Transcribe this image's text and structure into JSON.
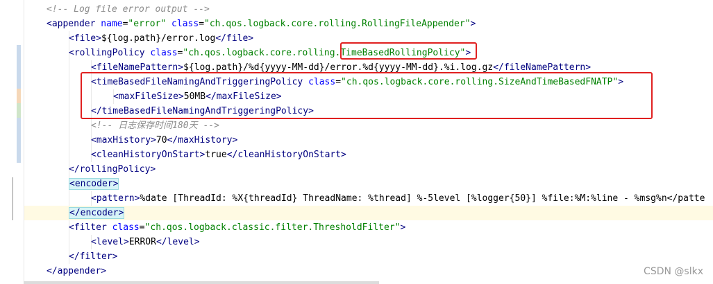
{
  "editor": {
    "language": "xml",
    "current_line_index": 14,
    "lines": [
      {
        "indent": 0,
        "tokens": [
          {
            "c": "comment",
            "t": "<!-- Log file error output -->"
          }
        ]
      },
      {
        "indent": 0,
        "tokens": [
          {
            "c": "tag",
            "t": "<appender "
          },
          {
            "c": "attr",
            "t": "name"
          },
          {
            "c": "text",
            "t": "="
          },
          {
            "c": "str",
            "t": "\"error\""
          },
          {
            "c": "text",
            "t": " "
          },
          {
            "c": "attr",
            "t": "class"
          },
          {
            "c": "text",
            "t": "="
          },
          {
            "c": "str",
            "t": "\"ch.qos.logback.core.rolling.RollingFileAppender\""
          },
          {
            "c": "tag",
            "t": ">"
          }
        ]
      },
      {
        "indent": 1,
        "tokens": [
          {
            "c": "tag",
            "t": "<file>"
          },
          {
            "c": "text",
            "t": "${log.path}/error.log"
          },
          {
            "c": "tag",
            "t": "</file>"
          }
        ]
      },
      {
        "indent": 1,
        "tokens": [
          {
            "c": "tag",
            "t": "<rollingPolicy "
          },
          {
            "c": "attr",
            "t": "class"
          },
          {
            "c": "text",
            "t": "="
          },
          {
            "c": "str",
            "t": "\"ch.qos.logback.core.rolling.TimeBasedRollingPolicy\""
          },
          {
            "c": "tag",
            "t": ">"
          }
        ]
      },
      {
        "indent": 2,
        "tokens": [
          {
            "c": "tag",
            "t": "<fileNamePattern>"
          },
          {
            "c": "text",
            "t": "${log.path}/%d{yyyy-MM-dd}/error.%d{yyyy-MM-dd}.%i.log.gz"
          },
          {
            "c": "tag",
            "t": "</fileNamePattern>"
          }
        ]
      },
      {
        "indent": 2,
        "tokens": [
          {
            "c": "tag",
            "t": "<timeBasedFileNamingAndTriggeringPolicy "
          },
          {
            "c": "attr",
            "t": "class"
          },
          {
            "c": "text",
            "t": "="
          },
          {
            "c": "str",
            "t": "\"ch.qos.logback.core.rolling.SizeAndTimeBasedFNATP\""
          },
          {
            "c": "tag",
            "t": ">"
          }
        ]
      },
      {
        "indent": 3,
        "tokens": [
          {
            "c": "tag",
            "t": "<maxFileSize>"
          },
          {
            "c": "text",
            "t": "50MB"
          },
          {
            "c": "tag",
            "t": "</maxFileSize>"
          }
        ]
      },
      {
        "indent": 2,
        "tokens": [
          {
            "c": "tag",
            "t": "</timeBasedFileNamingAndTriggeringPolicy>"
          }
        ]
      },
      {
        "indent": 2,
        "tokens": [
          {
            "c": "comment",
            "t": "<!-- 日志保存时间180天 -->"
          }
        ]
      },
      {
        "indent": 2,
        "tokens": [
          {
            "c": "tag",
            "t": "<maxHistory>"
          },
          {
            "c": "text",
            "t": "70"
          },
          {
            "c": "tag",
            "t": "</maxHistory>"
          }
        ]
      },
      {
        "indent": 2,
        "tokens": [
          {
            "c": "tag",
            "t": "<cleanHistoryOnStart>"
          },
          {
            "c": "text",
            "t": "true"
          },
          {
            "c": "tag",
            "t": "</cleanHistoryOnStart>"
          }
        ]
      },
      {
        "indent": 1,
        "tokens": [
          {
            "c": "tag",
            "t": "</rollingPolicy>"
          }
        ]
      },
      {
        "indent": 1,
        "tokens": [
          {
            "c": "taghl",
            "t": "<encoder>"
          }
        ]
      },
      {
        "indent": 2,
        "tokens": [
          {
            "c": "tag",
            "t": "<pattern>"
          },
          {
            "c": "text",
            "t": "%date [ThreadId: %X{threadId} ThreadName: %thread] %-5level [%logger{50}] %file:%M:%line - %msg%n</patte"
          }
        ]
      },
      {
        "indent": 1,
        "tokens": [
          {
            "c": "taghl",
            "t": "</encoder>"
          }
        ]
      },
      {
        "indent": 1,
        "tokens": [
          {
            "c": "tag",
            "t": "<filter "
          },
          {
            "c": "attr",
            "t": "class"
          },
          {
            "c": "text",
            "t": "="
          },
          {
            "c": "str",
            "t": "\"ch.qos.logback.classic.filter.ThresholdFilter\""
          },
          {
            "c": "tag",
            "t": ">"
          }
        ]
      },
      {
        "indent": 2,
        "tokens": [
          {
            "c": "tag",
            "t": "<level>"
          },
          {
            "c": "text",
            "t": "ERROR"
          },
          {
            "c": "tag",
            "t": "</level>"
          }
        ]
      },
      {
        "indent": 1,
        "tokens": [
          {
            "c": "tag",
            "t": "</filter>"
          }
        ]
      },
      {
        "indent": 0,
        "tokens": [
          {
            "c": "tag",
            "t": "</appender>"
          }
        ]
      }
    ]
  },
  "annotations": {
    "box1_text": "TimeBasedRollingPolicy",
    "box2_lines": "timeBasedFileNamingAndTriggeringPolicy block"
  },
  "gutter": {
    "intention_icon": "lightbulb-icon",
    "change_marker_colors": [
      "#c9d9ec",
      "#f5d7b8",
      "#cfe5c9",
      "#c9d9ec"
    ]
  },
  "watermark": "CSDN @slkx"
}
